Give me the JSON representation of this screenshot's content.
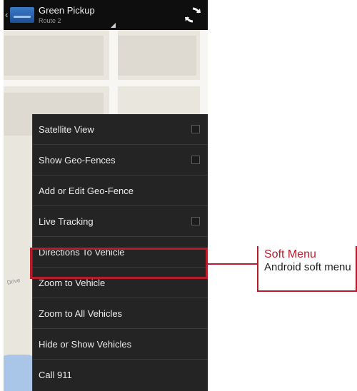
{
  "app_bar": {
    "title": "Green Pickup",
    "subtitle": "Route 2",
    "refresh_icon": "refresh-icon"
  },
  "map": {
    "street_label": "Drive"
  },
  "overflow_menu": {
    "items": [
      {
        "label": "Satellite View",
        "checkbox": true,
        "checked": false
      },
      {
        "label": "Show Geo-Fences",
        "checkbox": true,
        "checked": false
      },
      {
        "label": "Add or Edit Geo-Fence",
        "checkbox": false
      },
      {
        "label": "Live Tracking",
        "checkbox": true,
        "checked": false
      },
      {
        "label": "Directions To Vehicle",
        "checkbox": false
      },
      {
        "label": "Zoom to Vehicle",
        "checkbox": false,
        "highlighted": true
      },
      {
        "label": "Zoom to All Vehicles",
        "checkbox": false
      },
      {
        "label": "Hide or Show Vehicles",
        "checkbox": false
      },
      {
        "label": "Call 911",
        "checkbox": false
      }
    ]
  },
  "callout": {
    "title": "Soft Menu",
    "description": "Android soft menu",
    "color": "#b71c2a"
  }
}
